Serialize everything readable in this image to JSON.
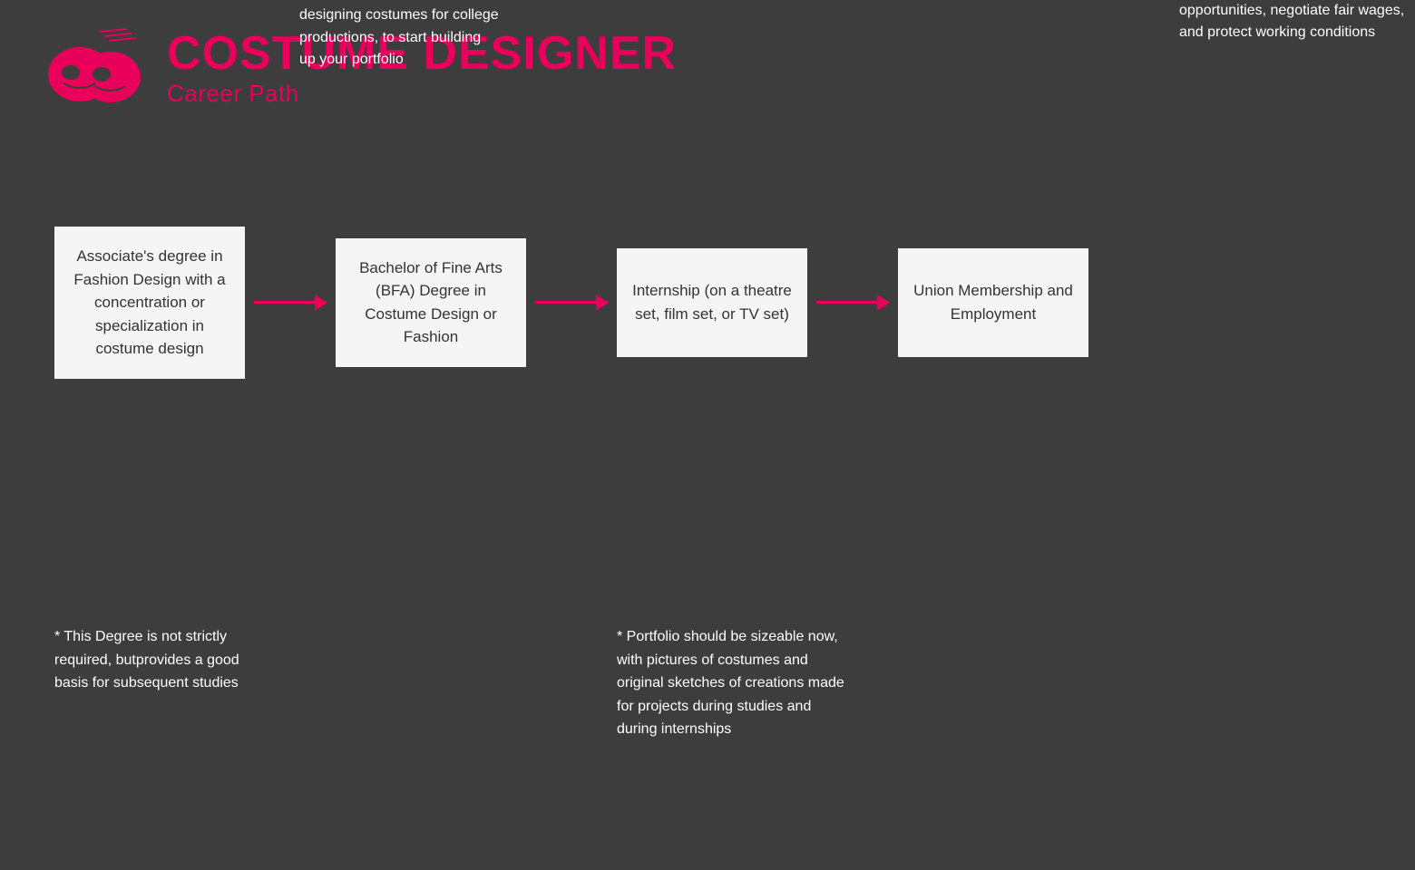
{
  "header": {
    "title": "COSTUME DESIGNER",
    "subtitle": "Career Path",
    "logo_alt": "theater mask icon"
  },
  "notes_above": {
    "bfa": "* Get involved with and start designing costumes for college productions, to start building up your portfolio",
    "union": "* Unions charge a membership fee but enhance employment opportunities, negotiate fair wages, and protect working conditions"
  },
  "boxes": [
    {
      "id": "associates",
      "text": "Associate's degree in Fashion Design with a concentration or specialization in costume design"
    },
    {
      "id": "bfa",
      "text": "Bachelor of Fine Arts (BFA) Degree in Costume Design or Fashion"
    },
    {
      "id": "internship",
      "text": "Internship (on a theatre set, film set, or TV set)"
    },
    {
      "id": "union",
      "text": "Union Membership and Employment"
    }
  ],
  "notes_below": {
    "associates": "* This Degree is not strictly required, butprovides a good basis for subsequent studies",
    "portfolio": "* Portfolio should be sizeable now, with pictures of costumes and original sketches of creations made for projects during studies and during internships"
  },
  "arrows": [
    "arrow1",
    "arrow2",
    "arrow3"
  ]
}
